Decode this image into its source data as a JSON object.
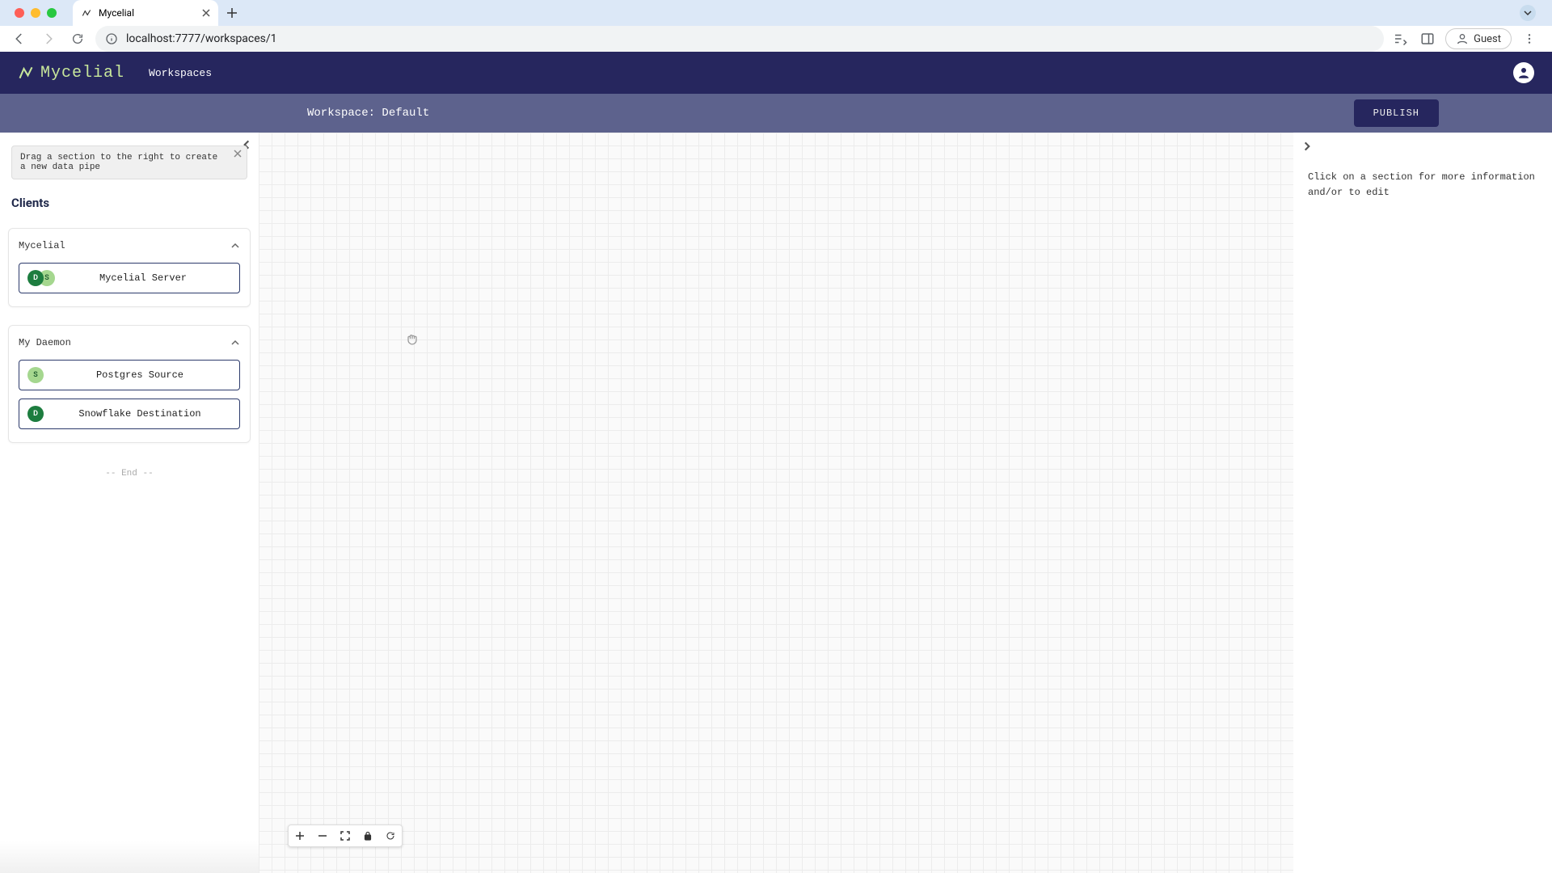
{
  "browser": {
    "tab_title": "Mycelial",
    "url": "localhost:7777/workspaces/1",
    "guest_label": "Guest"
  },
  "header": {
    "brand": "Mycelial",
    "nav_workspaces": "Workspaces"
  },
  "subheader": {
    "workspace_label": "Workspace: Default",
    "publish_label": "PUBLISH"
  },
  "left": {
    "hint": "Drag a section to the right to create a new data pipe",
    "clients_title": "Clients",
    "groups": [
      {
        "title": "Mycelial",
        "items": [
          {
            "label": "Mycelial Server",
            "badges": [
              "D",
              "S"
            ]
          }
        ]
      },
      {
        "title": "My Daemon",
        "items": [
          {
            "label": "Postgres Source",
            "badges": [
              "S"
            ]
          },
          {
            "label": "Snowflake Destination",
            "badges": [
              "D"
            ]
          }
        ]
      }
    ],
    "end_marker": "-- End --"
  },
  "right": {
    "info": "Click on a section for more information and/or to edit"
  },
  "colors": {
    "brand_navy": "#26265e",
    "subheader": "#5d628d",
    "logo_green": "#c7e69b",
    "badge_dark": "#1d7d3f",
    "badge_light": "#a5d78f"
  }
}
